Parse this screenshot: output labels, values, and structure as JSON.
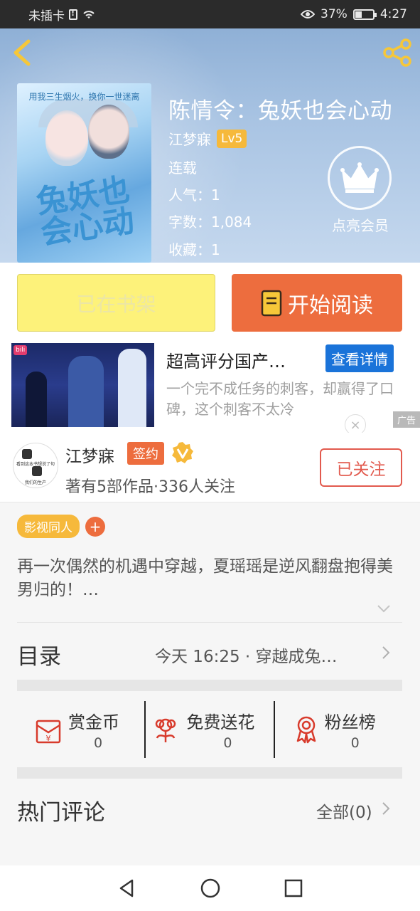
{
  "status_bar": {
    "carrier": "未插卡",
    "battery": "37%",
    "time": "4:27",
    "icons": [
      "sim-alert-icon",
      "wifi-icon",
      "eye-icon",
      "battery-icon"
    ]
  },
  "header": {
    "back_icon": "chevron-left-icon",
    "share_icon": "share-icon",
    "accent_color": "#f6b93b"
  },
  "book": {
    "cover_tagline": "用我三生烟火，换你一世迷离",
    "cover_title": "兔妖也会心动",
    "title": "陈情令：兔妖也会心动",
    "author": "江梦寐",
    "level": "Lv5",
    "status": "连载",
    "popularity": "人气：1",
    "word_count": "字数：1,084",
    "favorites": "收藏：1",
    "vip_label": "点亮会员"
  },
  "actions": {
    "shelf_label": "已在书架",
    "read_label": "开始阅读",
    "read_color": "#ed6d3e",
    "shelf_color": "#fdf27a"
  },
  "ad": {
    "image_tag": "bilibili",
    "title": "超高评分国产…",
    "detail_button": "查看详情",
    "description": "一个完不成任务的刺客，却赢得了口碑，这个刺客不太冷",
    "ad_label": "广告"
  },
  "author_card": {
    "name": "江梦寐",
    "sign_badge": "签约",
    "stats": "著有5部作品·336人关注",
    "follow_label": "已关注",
    "avatar_text_1": "看到这本书想说了句",
    "avatar_text_2": "我们的生产"
  },
  "tags": {
    "items": [
      "影视同人"
    ],
    "add_label": "+"
  },
  "synopsis": {
    "text": "再一次偶然的机遇中穿越，夏瑶瑶是逆风翻盘抱得美男归的！…"
  },
  "catalog": {
    "title": "目录",
    "latest": "今天 16:25 · 穿越成兔…"
  },
  "rewards": [
    {
      "label": "赏金币",
      "count": "0",
      "icon": "red-envelope-icon"
    },
    {
      "label": "免费送花",
      "count": "0",
      "icon": "flower-icon"
    },
    {
      "label": "粉丝榜",
      "count": "0",
      "icon": "medal-icon"
    }
  ],
  "comments": {
    "title": "热门评论",
    "all_label": "全部(0)"
  },
  "nav": {
    "icons": [
      "nav-back-icon",
      "nav-home-icon",
      "nav-recent-icon"
    ]
  }
}
